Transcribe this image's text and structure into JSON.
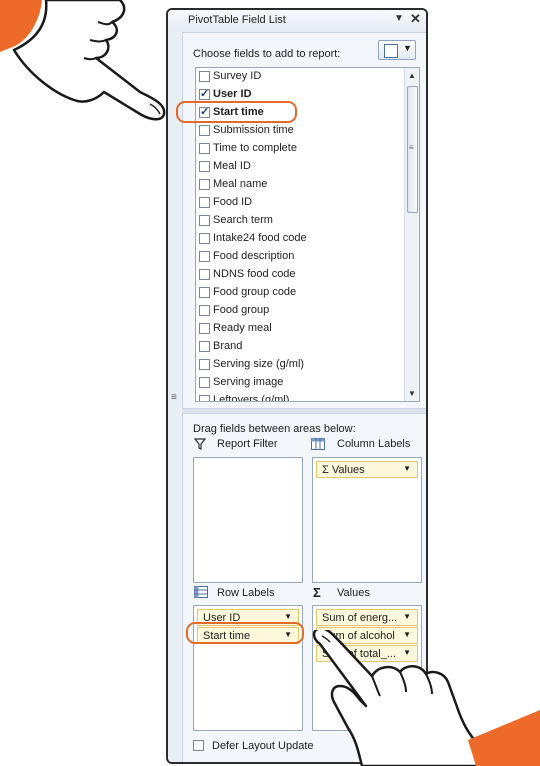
{
  "pane": {
    "title": "PivotTable Field List",
    "choose_label": "Choose fields to add to report:",
    "drag_label": "Drag fields between areas below:",
    "defer_label": "Defer Layout Update",
    "grip": "≡"
  },
  "fields": [
    {
      "label": "Survey ID",
      "checked": false,
      "bold": false
    },
    {
      "label": "User ID",
      "checked": true,
      "bold": true
    },
    {
      "label": "Start time",
      "checked": true,
      "bold": true
    },
    {
      "label": "Submission time",
      "checked": false,
      "bold": false
    },
    {
      "label": "Time to complete",
      "checked": false,
      "bold": false
    },
    {
      "label": "Meal ID",
      "checked": false,
      "bold": false
    },
    {
      "label": "Meal name",
      "checked": false,
      "bold": false
    },
    {
      "label": "Food ID",
      "checked": false,
      "bold": false
    },
    {
      "label": "Search term",
      "checked": false,
      "bold": false
    },
    {
      "label": "Intake24 food code",
      "checked": false,
      "bold": false
    },
    {
      "label": "Food description",
      "checked": false,
      "bold": false
    },
    {
      "label": "NDNS food code",
      "checked": false,
      "bold": false
    },
    {
      "label": "Food group code",
      "checked": false,
      "bold": false
    },
    {
      "label": "Food group",
      "checked": false,
      "bold": false
    },
    {
      "label": "Ready meal",
      "checked": false,
      "bold": false
    },
    {
      "label": "Brand",
      "checked": false,
      "bold": false
    },
    {
      "label": "Serving size (g/ml)",
      "checked": false,
      "bold": false
    },
    {
      "label": "Serving image",
      "checked": false,
      "bold": false
    },
    {
      "label": "Leftovers (g/ml)",
      "checked": false,
      "bold": false
    }
  ],
  "areas": {
    "report_filter": {
      "label": "Report Filter",
      "icon": "filter-icon",
      "items": []
    },
    "column_labels": {
      "label": "Column Labels",
      "icon": "column-labels-icon",
      "items": [
        "Σ  Values"
      ]
    },
    "row_labels": {
      "label": "Row Labels",
      "icon": "row-labels-icon",
      "items": [
        "User ID",
        "Start time"
      ]
    },
    "values": {
      "label": "Values",
      "icon": "sigma-icon",
      "items": [
        "Sum of energ...",
        "Sum of alcohol",
        "Sum of total_..."
      ]
    }
  },
  "colors": {
    "highlight": "#e36b2a",
    "chip_bg": "#fef8dc",
    "chip_border": "#e3c66a",
    "pane_bg": "#f3f6fb"
  }
}
